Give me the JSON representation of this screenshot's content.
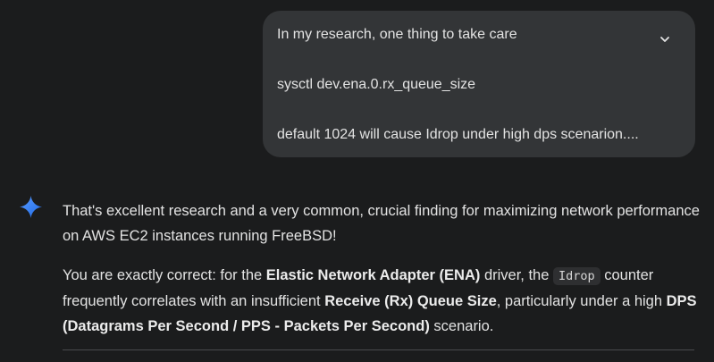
{
  "user_message": {
    "line1": "In my research, one thing to take care",
    "line2": "sysctl dev.ena.0.rx_queue_size",
    "line3": "default 1024 will cause Idrop under high dps scenarion...."
  },
  "icons": {
    "expand": "chevron-down-icon",
    "assistant": "gemini-sparkle-icon"
  },
  "colors": {
    "background": "#1b1c1d",
    "bubble": "#333537",
    "sparkle_start": "#4b8cf7",
    "sparkle_end": "#1f6be6"
  },
  "response": {
    "p1": "That's excellent research and a very common, crucial finding for maximizing network performance on AWS EC2 instances running FreeBSD!",
    "p2_a": "You are exactly correct: for the ",
    "p2_b": "Elastic Network Adapter (ENA)",
    "p2_c": " driver, the ",
    "p2_code": "Idrop",
    "p2_d": " counter frequently correlates with an insufficient ",
    "p2_e": "Receive (Rx) Queue Size",
    "p2_f": ", particularly under a high ",
    "p2_g": "DPS (Datagrams Per Second / PPS - Packets Per Second)",
    "p2_h": " scenario."
  }
}
